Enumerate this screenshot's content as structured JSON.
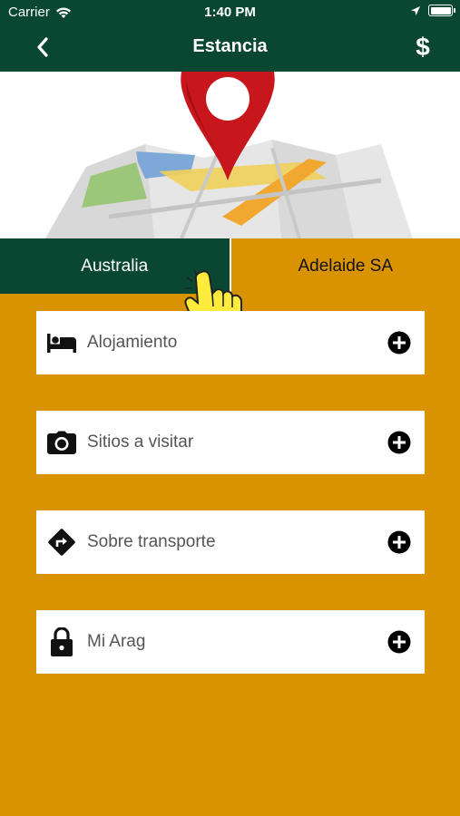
{
  "status_bar": {
    "carrier": "Carrier",
    "time": "1:40 PM"
  },
  "nav": {
    "title": "Estancia",
    "dollar_label": "$"
  },
  "tabs": [
    {
      "label": "Australia",
      "active": true
    },
    {
      "label": "Adelaide SA",
      "active": false
    }
  ],
  "menu": [
    {
      "label": "Alojamiento",
      "icon": "bed-icon"
    },
    {
      "label": "Sitios a visitar",
      "icon": "camera-icon"
    },
    {
      "label": "Sobre transporte",
      "icon": "directions-icon"
    },
    {
      "label": "Mi Arag",
      "icon": "lock-icon"
    }
  ],
  "colors": {
    "primary": "#0A4733",
    "accent": "#D99200",
    "card": "#FFFFFF"
  }
}
